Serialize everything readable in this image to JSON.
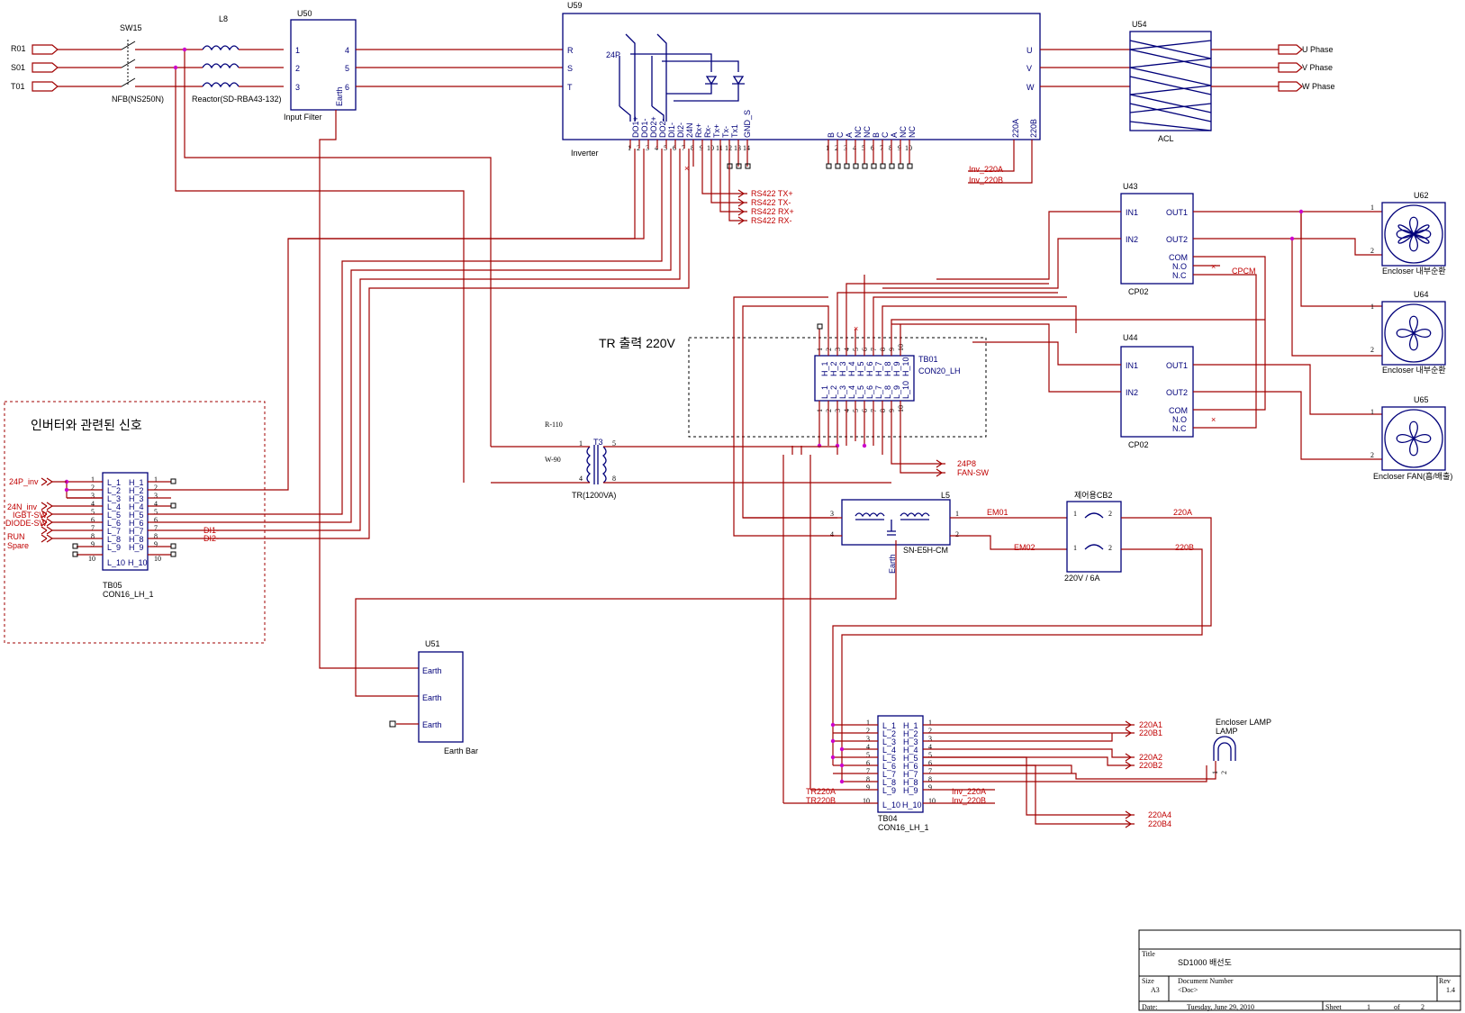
{
  "inputs": [
    "R01",
    "S01",
    "T01"
  ],
  "sw15": {
    "ref": "SW15",
    "label": "NFB(NS250N)"
  },
  "l8": {
    "ref": "L8",
    "label": "Reactor(SD-RBA43-132)"
  },
  "u50": {
    "ref": "U50",
    "label": "Input Filter",
    "pins_left": [
      "1",
      "2",
      "3"
    ],
    "pins_right": [
      "4",
      "5",
      "6"
    ],
    "earth": "Earth"
  },
  "u59": {
    "ref": "U59",
    "label": "Inverter",
    "left_pins": [
      "R",
      "S",
      "T"
    ],
    "right_pins": [
      "U",
      "V",
      "W"
    ],
    "tag_24p": "24P",
    "io_labels": [
      "DO1+",
      "DO1-",
      "DO2+",
      "DO2-",
      "DI1-",
      "DI2-",
      "24N",
      "Rx+",
      "Rx-",
      "Tx+",
      "Tx-",
      "Tx1",
      "GND_S"
    ],
    "io_nums": [
      "1",
      "2",
      "3",
      "4",
      "5",
      "6",
      "7",
      "8",
      "9",
      "10",
      "11",
      "12",
      "13",
      "14"
    ],
    "relay_labels": [
      "B",
      "C",
      "A",
      "NC",
      "NC",
      "B",
      "C",
      "A",
      "NC",
      "NC"
    ],
    "relay_nums": [
      "1",
      "2",
      "3",
      "4",
      "5",
      "6",
      "7",
      "8",
      "9",
      "10"
    ],
    "ac_labels": [
      "220A",
      "220B"
    ]
  },
  "rs422": [
    "RS422 TX+",
    "RS422 TX-",
    "RS422 RX+",
    "RS422 RX-"
  ],
  "inv_220": [
    "Inv_220A",
    "Inv_220B"
  ],
  "u54": {
    "ref": "U54",
    "label": "ACL"
  },
  "phases": [
    "U Phase",
    "V Phase",
    "W Phase"
  ],
  "u43": {
    "ref": "U43",
    "label": "CP02",
    "pins": [
      "IN1",
      "IN2",
      "OUT1",
      "OUT2",
      "COM",
      "N.O",
      "N.C"
    ]
  },
  "u44": {
    "ref": "U44",
    "label": "CP02",
    "pins": [
      "IN1",
      "IN2",
      "OUT1",
      "OUT2",
      "COM",
      "N.O",
      "N.C"
    ]
  },
  "cpcm": "CPCM",
  "u62": {
    "ref": "U62",
    "label": "Encloser 내부순환",
    "pins": [
      "1",
      "2"
    ]
  },
  "u64": {
    "ref": "U64",
    "label": "Encloser 내부순환",
    "pins": [
      "1",
      "2"
    ]
  },
  "u65": {
    "ref": "U65",
    "label": "Encloser FAN(흡/배출)",
    "pins": [
      "1",
      "2"
    ]
  },
  "tr_box_label": "TR 출력 220V",
  "tb01": {
    "ref": "TB01",
    "label": "CON20_LH",
    "top_pins": [
      "H_1",
      "H_2",
      "H_3",
      "H_4",
      "H_5",
      "H_6",
      "H_7",
      "H_8",
      "H_9",
      "H_10"
    ],
    "bot_pins": [
      "L_1",
      "L_2",
      "L_3",
      "L_4",
      "L_5",
      "L_6",
      "L_7",
      "L_8",
      "L_9",
      "L_10"
    ],
    "nums": [
      "1",
      "2",
      "3",
      "4",
      "5",
      "6",
      "7",
      "8",
      "9",
      "10"
    ]
  },
  "fan_out": [
    "24P8",
    "FAN-SW"
  ],
  "t3": {
    "ref": "T3",
    "label": "TR(1200VA)",
    "in_top": "R-110",
    "in_bot": "W-90",
    "pins": [
      "1",
      "4",
      "5",
      "8"
    ]
  },
  "l5": {
    "ref": "L5",
    "label": "SN-E5H-CM",
    "earth": "Earth",
    "pins": [
      "3",
      "4",
      "1",
      "2"
    ]
  },
  "em": [
    "EM01",
    "EM02"
  ],
  "cb2": {
    "ref": "제어용CB2",
    "label": "220V / 6A",
    "pins": [
      "1",
      "2",
      "1",
      "2"
    ]
  },
  "cb_out": [
    "220A",
    "220B"
  ],
  "signals_box_title": "인버터와 관련된 신호",
  "tb05": {
    "ref": "TB05",
    "label": "CON16_LH_1",
    "rows": [
      {
        "n": "1",
        "l": "L_1",
        "h": "H_1"
      },
      {
        "n": "2",
        "l": "L_2",
        "h": "H_2"
      },
      {
        "n": "3",
        "l": "L_3",
        "h": "H_3"
      },
      {
        "n": "4",
        "l": "L_4",
        "h": "H_4"
      },
      {
        "n": "5",
        "l": "L_5",
        "h": "H_5"
      },
      {
        "n": "6",
        "l": "L_6",
        "h": "H_6"
      },
      {
        "n": "7",
        "l": "L_7",
        "h": "H_7"
      },
      {
        "n": "8",
        "l": "L_8",
        "h": "H_8"
      },
      {
        "n": "9",
        "l": "L_9",
        "h": "H_9"
      },
      {
        "n": "10",
        "l": "L_10",
        "h": "H_10"
      }
    ],
    "signals": [
      "24P_inv",
      "24N_inv",
      "IGBT-SW",
      "DIODE-SW",
      "RUN",
      "Spare"
    ],
    "di": [
      "DI1-",
      "DI2-"
    ]
  },
  "u51": {
    "ref": "U51",
    "label": "Earth Bar",
    "pins": [
      "Earth",
      "Earth",
      "Earth"
    ]
  },
  "tb04": {
    "ref": "TB04",
    "label": "CON16_LH_1",
    "rows": [
      {
        "n": "1",
        "l": "L_1",
        "h": "H_1"
      },
      {
        "n": "2",
        "l": "L_2",
        "h": "H_2"
      },
      {
        "n": "3",
        "l": "L_3",
        "h": "H_3"
      },
      {
        "n": "4",
        "l": "L_4",
        "h": "H_4"
      },
      {
        "n": "5",
        "l": "L_5",
        "h": "H_5"
      },
      {
        "n": "6",
        "l": "L_6",
        "h": "H_6"
      },
      {
        "n": "7",
        "l": "L_7",
        "h": "H_7"
      },
      {
        "n": "8",
        "l": "L_8",
        "h": "H_8"
      },
      {
        "n": "9",
        "l": "L_9",
        "h": "H_9"
      },
      {
        "n": "10",
        "l": "L_10",
        "h": "H_10"
      }
    ],
    "left_labels": [
      "TR220A",
      "TR220B"
    ],
    "right_labels": [
      "Inv_220A",
      "Inv_220B"
    ],
    "outputs": [
      "220A1",
      "220B1",
      "220A2",
      "220B2",
      "220A4",
      "220B4"
    ]
  },
  "lamp": {
    "label1": "Encloser LAMP",
    "label2": "LAMP",
    "pins": [
      "1",
      "2"
    ]
  },
  "title_block": {
    "title_label": "Title",
    "title": "SD1000 배선도",
    "size_label": "Size",
    "size": "A3",
    "docnum_label": "Document Number",
    "docnum": "<Doc>",
    "rev_label": "Rev",
    "rev": "1.4",
    "date_label": "Date:",
    "date": "Tuesday, June 29, 2010",
    "sheet_label": "Sheet",
    "sheet": "1",
    "of_label": "of",
    "of": "2"
  }
}
